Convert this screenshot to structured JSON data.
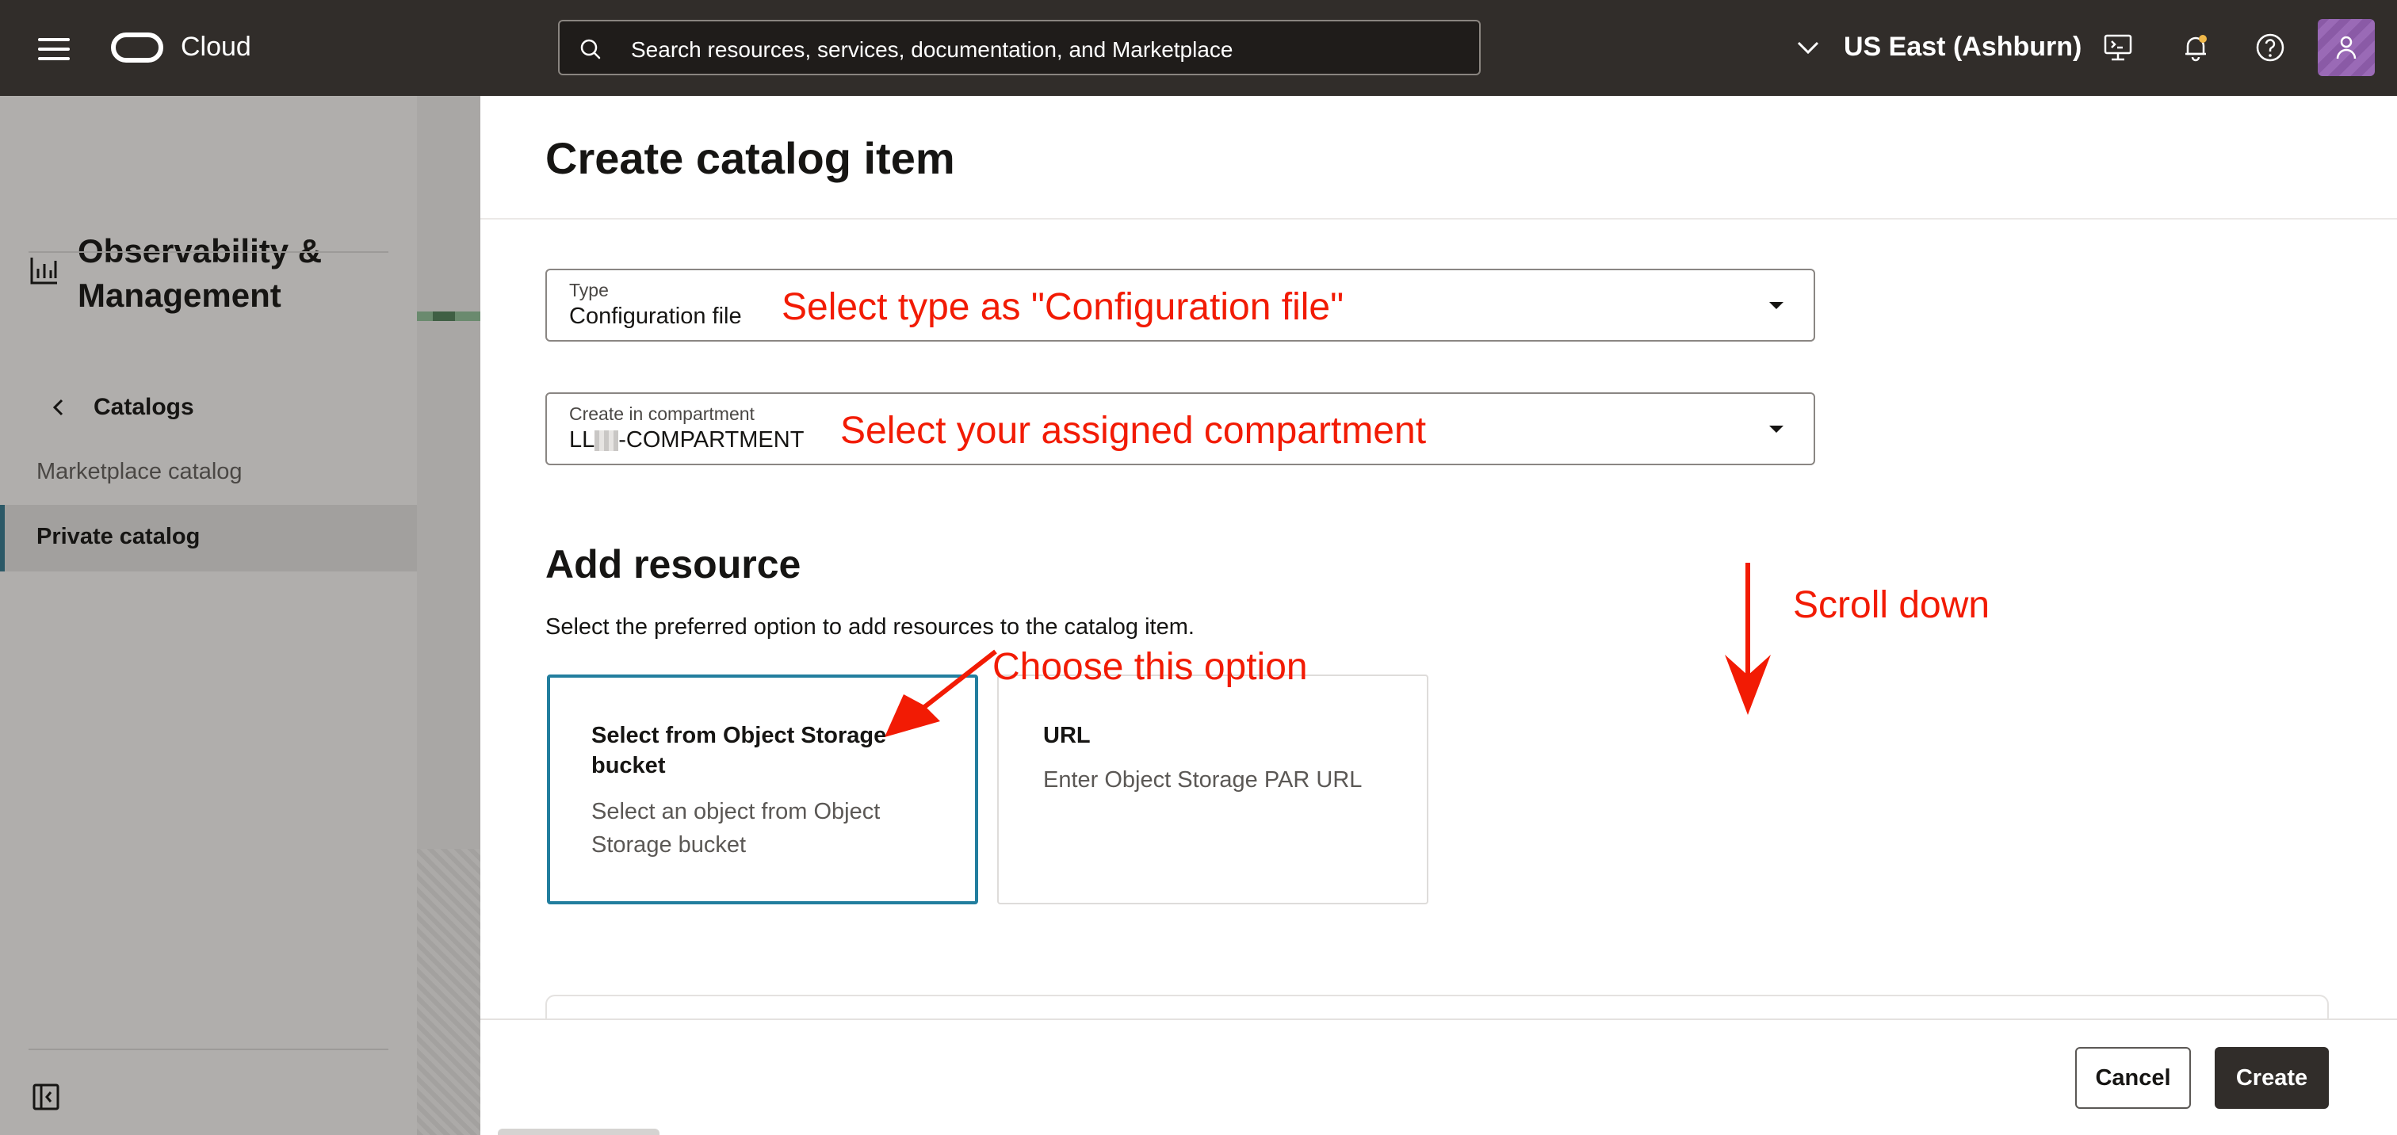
{
  "topbar": {
    "brand": "Cloud",
    "search_placeholder": "Search resources, services, documentation, and Marketplace",
    "region": "US East (Ashburn)"
  },
  "sidebar": {
    "title": "Observability & Management",
    "back_label": "Catalogs",
    "items": [
      {
        "label": "Marketplace catalog",
        "selected": false
      },
      {
        "label": "Private catalog",
        "selected": true
      }
    ]
  },
  "panel": {
    "title": "Create catalog item",
    "type_field": {
      "label": "Type",
      "value": "Configuration file"
    },
    "compartment_field": {
      "label": "Create in compartment",
      "value_prefix": "LL",
      "value_suffix": "-COMPARTMENT"
    },
    "section_title": "Add resource",
    "section_desc": "Select the preferred option to add resources to the catalog item.",
    "options": [
      {
        "title": "Select from Object Storage bucket",
        "desc": "Select an object from Object Storage bucket",
        "selected": true
      },
      {
        "title": "URL",
        "desc": "Enter Object Storage PAR URL",
        "selected": false
      }
    ],
    "cancel_label": "Cancel",
    "create_label": "Create"
  },
  "annotations": {
    "type": "Select type as \"Configuration file\"",
    "compartment": "Select your assigned compartment",
    "scroll": "Scroll down",
    "choose": "Choose this option",
    "color": "#f21b04"
  },
  "colors": {
    "topbar": "#312d2a",
    "selected_border": "#227e9e",
    "primary_button": "#312d2a"
  }
}
